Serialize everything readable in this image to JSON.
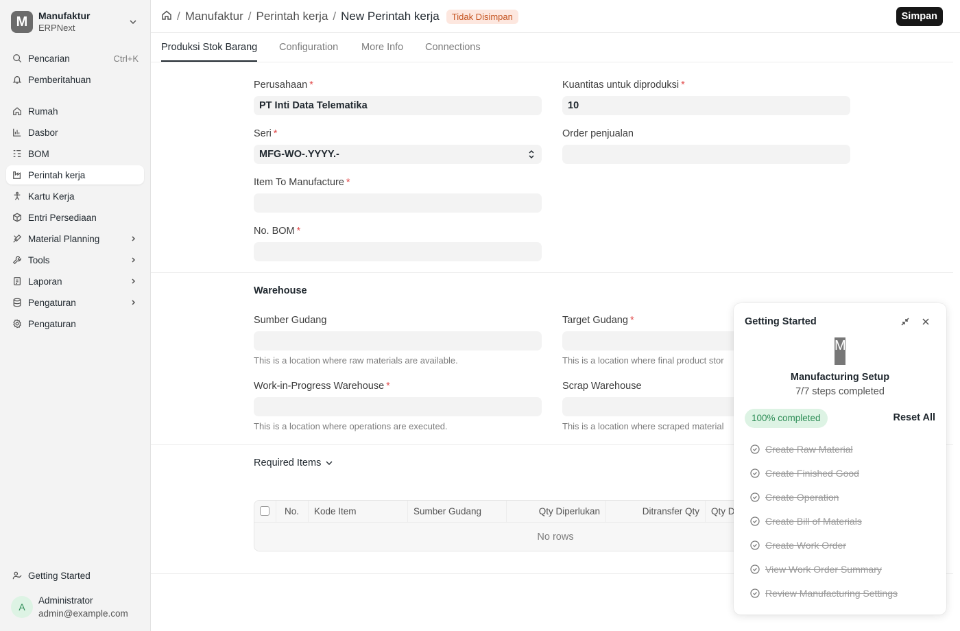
{
  "workspace": {
    "initial": "M",
    "name": "Manufaktur",
    "subtitle": "ERPNext"
  },
  "sidebar": {
    "search": {
      "label": "Pencarian",
      "shortcut": "Ctrl+K"
    },
    "notifications": "Pemberitahuan",
    "items": [
      {
        "label": "Rumah",
        "icon": "home-icon"
      },
      {
        "label": "Dasbor",
        "icon": "chart-icon"
      },
      {
        "label": "BOM",
        "icon": "list-icon"
      },
      {
        "label": "Perintah kerja",
        "icon": "factory-icon"
      },
      {
        "label": "Kartu Kerja",
        "icon": "person-icon"
      },
      {
        "label": "Entri Persediaan",
        "icon": "box-icon"
      },
      {
        "label": "Material Planning",
        "icon": "tools-icon"
      },
      {
        "label": "Tools",
        "icon": "wrench-icon"
      },
      {
        "label": "Laporan",
        "icon": "report-icon"
      },
      {
        "label": "Pengaturan",
        "icon": "database-icon"
      },
      {
        "label": "Pengaturan",
        "icon": "gear-icon"
      }
    ],
    "getting_started": "Getting Started",
    "user": {
      "initial": "A",
      "name": "Administrator",
      "email": "admin@example.com"
    }
  },
  "header": {
    "crumb1": "Manufaktur",
    "crumb2": "Perintah kerja",
    "title": "New Perintah kerja",
    "status": "Tidak Disimpan",
    "save": "Simpan"
  },
  "tabs": [
    "Produksi Stok Barang",
    "Configuration",
    "More Info",
    "Connections"
  ],
  "form": {
    "company_label": "Perusahaan",
    "company_value": "PT Inti Data Telematika",
    "qty_label": "Kuantitas untuk diproduksi",
    "qty_value": "10",
    "series_label": "Seri",
    "series_value": "MFG-WO-.YYYY.-",
    "sales_order_label": "Order penjualan",
    "item_label": "Item To Manufacture",
    "bom_label": "No. BOM"
  },
  "warehouse": {
    "title": "Warehouse",
    "source_label": "Sumber Gudang",
    "source_desc": "This is a location where raw materials are available.",
    "target_label": "Target Gudang",
    "target_desc": "This is a location where final product stor",
    "wip_label": "Work-in-Progress Warehouse",
    "wip_desc": "This is a location where operations are executed.",
    "scrap_label": "Scrap Warehouse",
    "scrap_desc": "This is a location where scraped material"
  },
  "required_items": {
    "title": "Required Items",
    "columns": [
      "No.",
      "Kode Item",
      "Sumber Gudang",
      "Qty Diperlukan",
      "Ditransfer Qty",
      "Qty D"
    ],
    "empty": "No rows"
  },
  "getting_started_panel": {
    "title": "Getting Started",
    "logo": "M",
    "name": "Manufacturing Setup",
    "steps_text": "7/7 steps completed",
    "progress": "100% completed",
    "reset": "Reset All",
    "steps": [
      "Create Raw Material",
      "Create Finished Good",
      "Create Operation",
      "Create Bill of Materials",
      "Create Work Order",
      "View Work Order Summary",
      "Review Manufacturing Settings"
    ]
  }
}
